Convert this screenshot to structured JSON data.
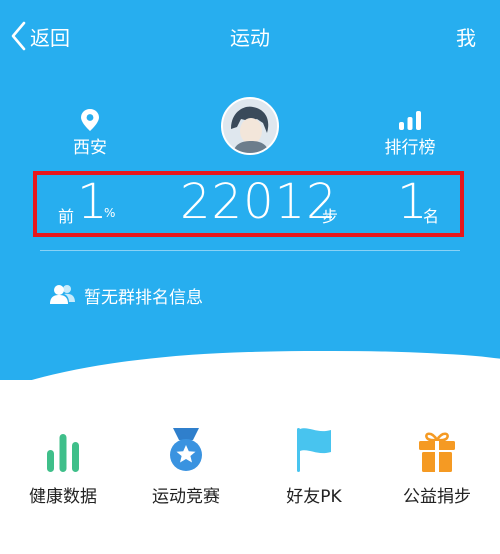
{
  "header": {
    "back_label": "返回",
    "title": "运动",
    "me_label": "我"
  },
  "profile": {
    "city": "西安",
    "ranking_label": "排行榜"
  },
  "stats": {
    "percent_prefix": "前",
    "percent_value": "1",
    "percent_unit": "%",
    "steps_value": "22012",
    "steps_unit": "步",
    "rank_value": "1",
    "rank_unit": "名"
  },
  "group_info": "暂无群排名信息",
  "menu": [
    {
      "label": "健康数据",
      "icon": "bar-chart-icon",
      "color": "#3fbf8a"
    },
    {
      "label": "运动竞赛",
      "icon": "medal-icon",
      "color": "#3a93e0"
    },
    {
      "label": "好友PK",
      "icon": "flag-icon",
      "color": "#48c4ef"
    },
    {
      "label": "公益捐步",
      "icon": "gift-icon",
      "color": "#f59a23"
    }
  ],
  "colors": {
    "hero": "#27aeef",
    "highlight_box": "#e8161c"
  }
}
